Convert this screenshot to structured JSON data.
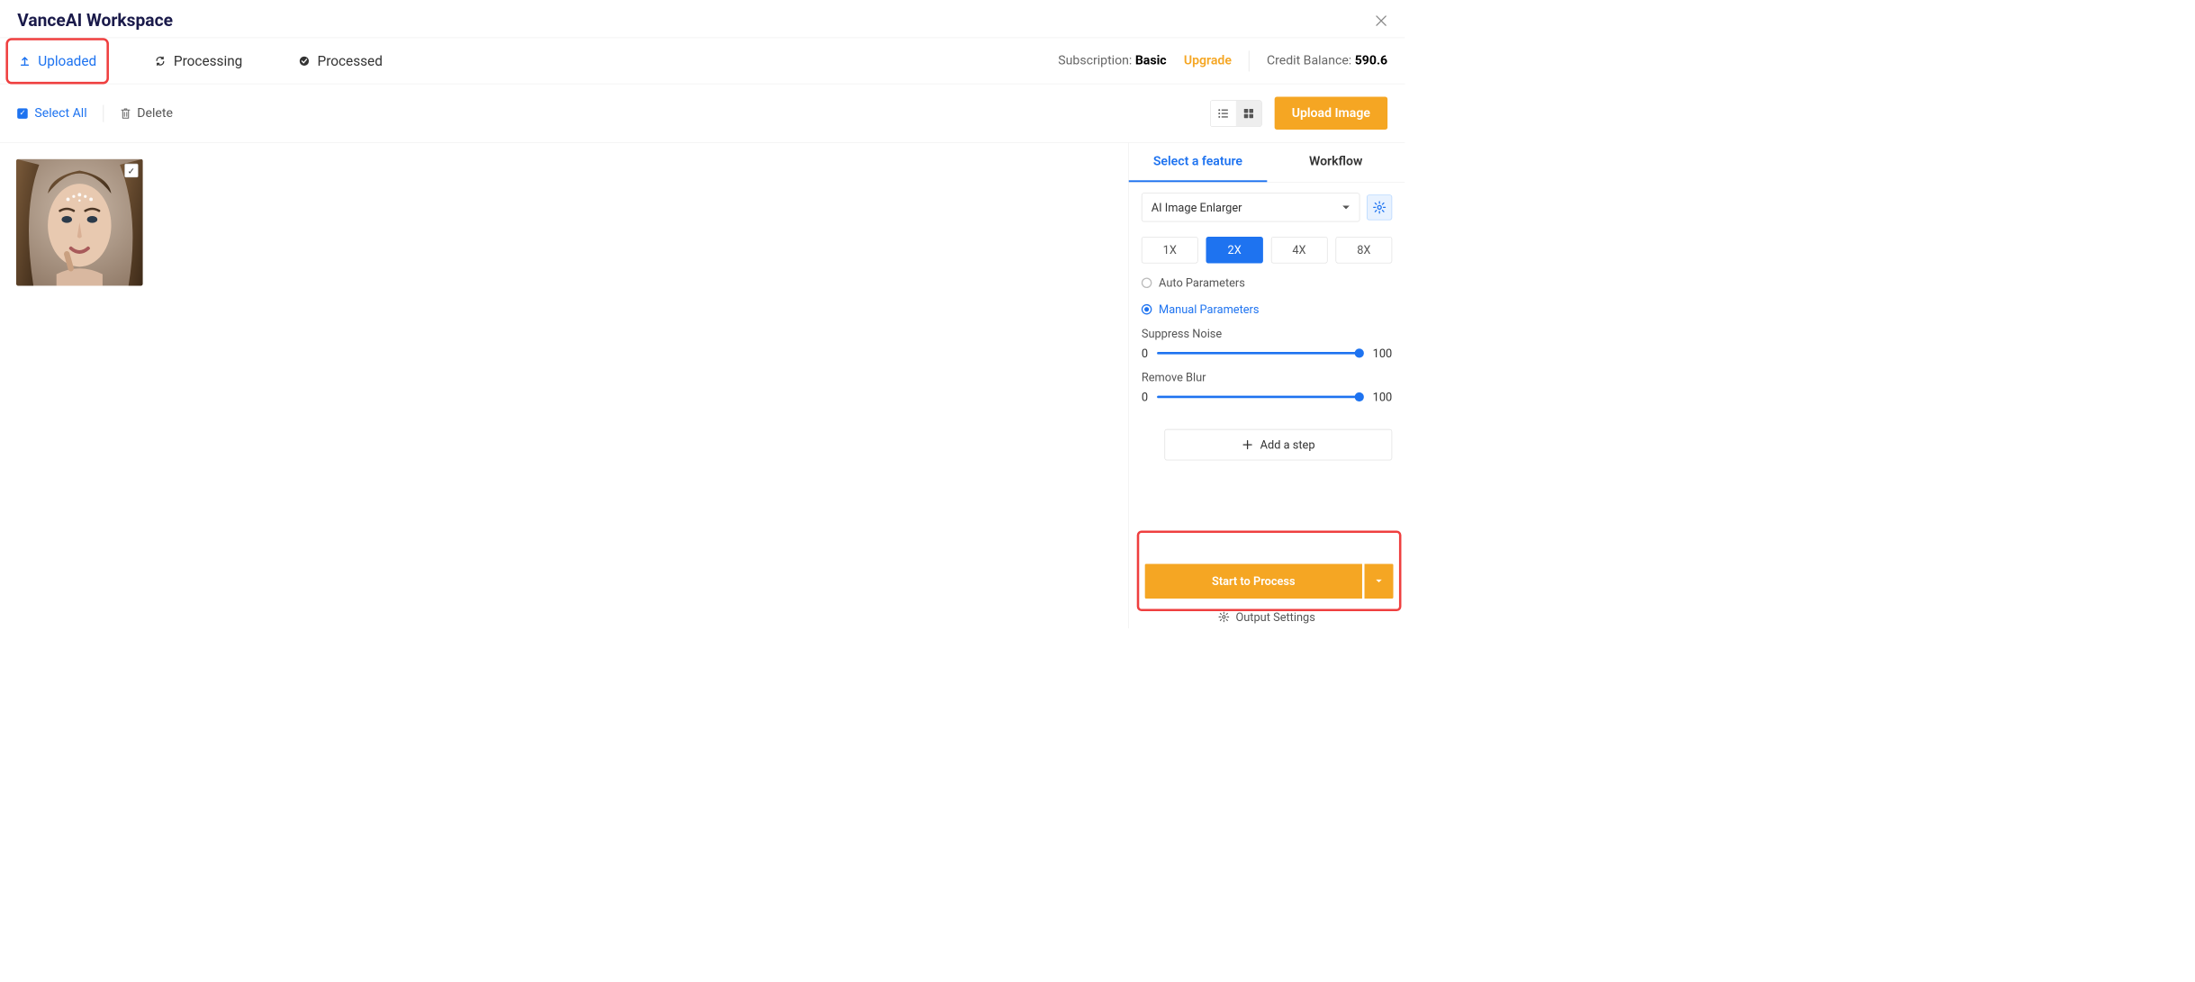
{
  "header": {
    "title": "VanceAI Workspace"
  },
  "tabs": {
    "items": [
      {
        "label": "Uploaded",
        "active": true
      },
      {
        "label": "Processing",
        "active": false
      },
      {
        "label": "Processed",
        "active": false
      }
    ]
  },
  "account": {
    "subscription_label": "Subscription:",
    "plan": "Basic",
    "upgrade": "Upgrade",
    "balance_label": "Credit Balance:",
    "balance": "590.6"
  },
  "toolbar": {
    "select_all": "Select All",
    "delete": "Delete",
    "upload": "Upload Image"
  },
  "side": {
    "tabs": {
      "feature": "Select a feature",
      "workflow": "Workflow"
    },
    "feature_selected": "AI Image Enlarger",
    "scales": [
      "1X",
      "2X",
      "4X",
      "8X"
    ],
    "scale_active": "2X",
    "auto_params": "Auto Parameters",
    "manual_params": "Manual Parameters",
    "suppress_noise": {
      "label": "Suppress Noise",
      "min": "0",
      "max": "100"
    },
    "remove_blur": {
      "label": "Remove Blur",
      "min": "0",
      "max": "100"
    },
    "add_step": "Add a step",
    "process": "Start to Process",
    "output_settings": "Output Settings"
  }
}
